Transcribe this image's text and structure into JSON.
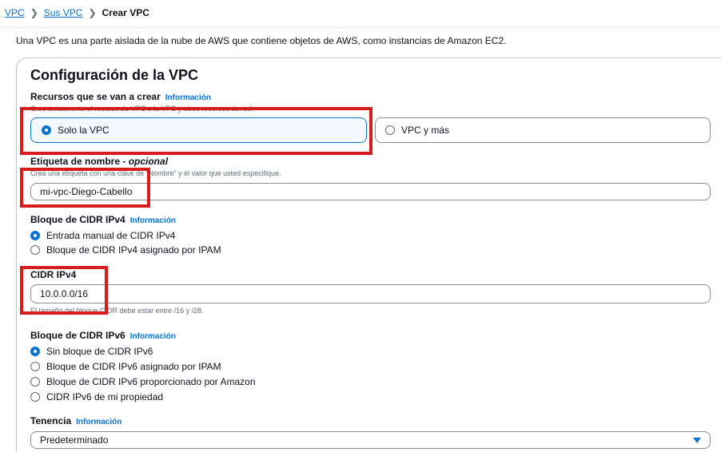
{
  "breadcrumb": {
    "items": [
      "VPC",
      "Sus VPC"
    ],
    "current": "Crear VPC"
  },
  "intro_text": "Una VPC es una parte aislada de la nube de AWS que contiene objetos de AWS, como instancias de Amazon EC2.",
  "panel": {
    "title": "Configuración de la VPC"
  },
  "resources": {
    "label": "Recursos que se van a crear",
    "info": "Información",
    "description": "Cree únicamente el recurso de VPC o la VPC y otros recursos de red.",
    "options": [
      "Solo la VPC",
      "VPC y más"
    ],
    "selected": "Solo la VPC"
  },
  "name_tag": {
    "label": "Etiqueta de nombre -",
    "optional": "opcional",
    "description": "Crea una etiqueta con una clave de “Nombre” y el valor que usted especifique.",
    "value": "mi-vpc-Diego-Cabello"
  },
  "ipv4_block": {
    "label": "Bloque de CIDR IPv4",
    "info": "Información",
    "options": [
      "Entrada manual de CIDR IPv4",
      "Bloque de CIDR IPv4 asignado por IPAM"
    ],
    "selected": "Entrada manual de CIDR IPv4"
  },
  "ipv4_cidr": {
    "label": "CIDR IPv4",
    "value": "10.0.0.0/16",
    "hint": "El tamaño del bloque CIDR debe estar entre /16 y /28."
  },
  "ipv6_block": {
    "label": "Bloque de CIDR IPv6",
    "info": "Información",
    "options": [
      "Sin bloque de CIDR IPv6",
      "Bloque de CIDR IPv6 asignado por IPAM",
      "Bloque de CIDR IPv6 proporcionado por Amazon",
      "CIDR IPv6 de mi propiedad"
    ],
    "selected": "Sin bloque de CIDR IPv6"
  },
  "tenancy": {
    "label": "Tenencia",
    "info": "Información",
    "value": "Predeterminado"
  },
  "colors": {
    "link": "#0972d3",
    "highlight": "#d81b1b",
    "selected_tile_bg": "#f2f8fd"
  }
}
